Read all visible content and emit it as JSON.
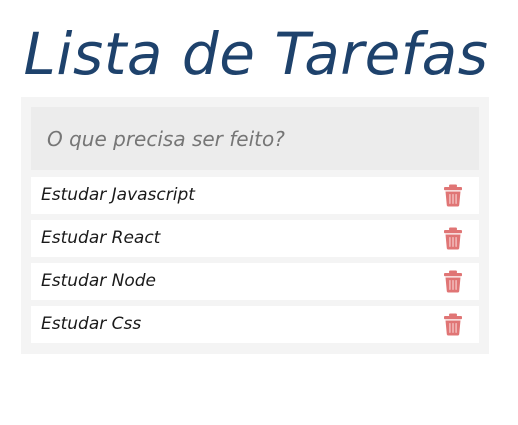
{
  "header": {
    "title": "Lista de Tarefas"
  },
  "new_todo": {
    "placeholder": "O que precisa ser feito?",
    "value": ""
  },
  "todos": [
    {
      "label": "Estudar Javascript"
    },
    {
      "label": "Estudar React"
    },
    {
      "label": "Estudar Node"
    },
    {
      "label": "Estudar Css"
    }
  ],
  "icons": {
    "delete": "trash-icon"
  },
  "colors": {
    "title": "#1e426c",
    "panel": "#f4f4f4",
    "input_bg": "#ececec",
    "item_bg": "#ffffff",
    "trash": "#e07575"
  }
}
